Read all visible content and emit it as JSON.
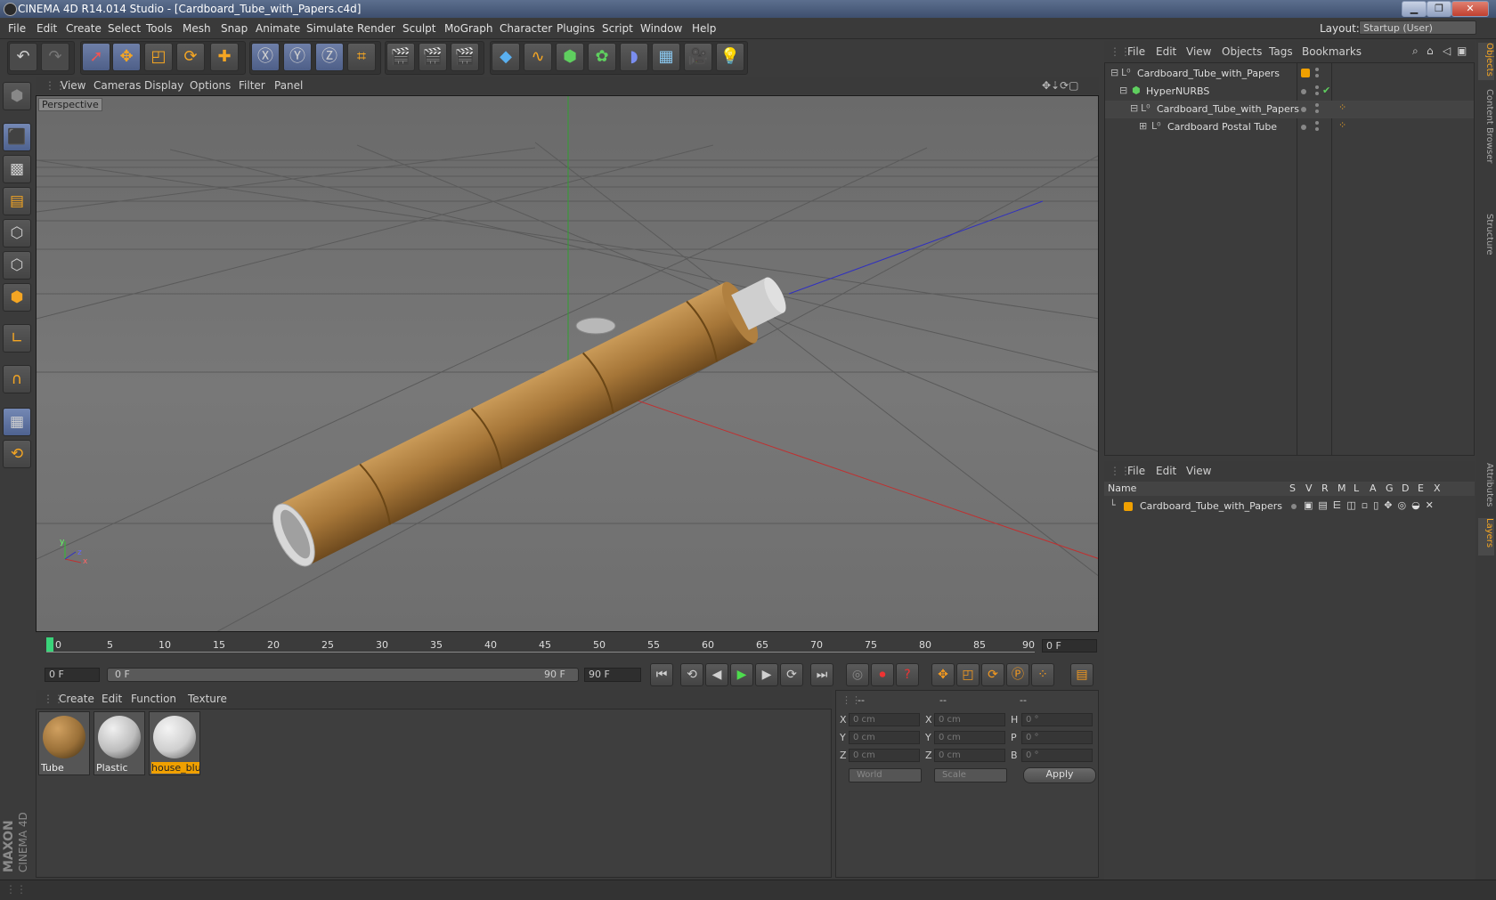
{
  "titlebar": {
    "title": "CINEMA 4D R14.014 Studio - [Cardboard_Tube_with_Papers.c4d]",
    "minimize": "▁",
    "maximize": "❐",
    "close": "✕"
  },
  "menubar": {
    "items": [
      "File",
      "Edit",
      "Create",
      "Select",
      "Tools",
      "Mesh",
      "Snap",
      "Animate",
      "Simulate",
      "Render",
      "Sculpt",
      "MoGraph",
      "Character",
      "Plugins",
      "Script",
      "Window",
      "Help"
    ],
    "layout_label": "Layout:",
    "layout_value": "Startup (User)"
  },
  "viewport": {
    "menu": [
      "View",
      "Cameras",
      "Display",
      "Options",
      "Filter",
      "Panel"
    ],
    "label": "Perspective",
    "axis": {
      "x": "x",
      "y": "y",
      "z": "z"
    }
  },
  "timeline": {
    "ticks": [
      "0",
      "5",
      "10",
      "15",
      "20",
      "25",
      "30",
      "35",
      "40",
      "45",
      "50",
      "55",
      "60",
      "65",
      "70",
      "75",
      "80",
      "85",
      "90"
    ],
    "current_frame": "0 F"
  },
  "transport": {
    "start": "0 F",
    "range_start": "0 F",
    "range_end": "90 F",
    "end": "90 F"
  },
  "materials": {
    "menu": [
      "Create",
      "Edit",
      "Function",
      "Texture"
    ],
    "items": [
      {
        "label": "Tube",
        "color": "#9a7038"
      },
      {
        "label": "Plastic",
        "color": "#bdbdbd"
      },
      {
        "label": "house_blu",
        "color": "#cfcfcf"
      }
    ]
  },
  "coords": {
    "header_a": "--",
    "header_b": "--",
    "header_c": "--",
    "rows": [
      {
        "l1": "X",
        "v1": "0 cm",
        "l2": "X",
        "v2": "0 cm",
        "l3": "H",
        "v3": "0 °"
      },
      {
        "l1": "Y",
        "v1": "0 cm",
        "l2": "Y",
        "v2": "0 cm",
        "l3": "P",
        "v3": "0 °"
      },
      {
        "l1": "Z",
        "v1": "0 cm",
        "l2": "Z",
        "v2": "0 cm",
        "l3": "B",
        "v3": "0 °"
      }
    ],
    "world": "World",
    "scale": "Scale",
    "apply": "Apply"
  },
  "objects": {
    "menu": [
      "File",
      "Edit",
      "View",
      "Objects",
      "Tags",
      "Bookmarks"
    ],
    "rows": [
      {
        "name": "Cardboard_Tube_with_Papers"
      },
      {
        "name": "HyperNURBS"
      },
      {
        "name": "Cardboard_Tube_with_Papers"
      },
      {
        "name": "Cardboard Postal Tube"
      }
    ]
  },
  "layers": {
    "menu": [
      "File",
      "Edit",
      "View"
    ],
    "headers": {
      "name": "Name",
      "s": "S",
      "v": "V",
      "r": "R",
      "m": "M",
      "l": "L",
      "a": "A",
      "g": "G",
      "d": "D",
      "e": "E",
      "x": "X"
    },
    "row": "Cardboard_Tube_with_Papers"
  },
  "right_tabs": [
    "Objects",
    "Content Browser",
    "Structure",
    "Attributes",
    "Layers"
  ],
  "brand": {
    "line1": "MAXON",
    "line2": "CINEMA 4D"
  },
  "colors": {
    "accent": "#f0a000",
    "x_axis": "#c03030",
    "y_axis": "#30a030",
    "z_axis": "#3030c0"
  }
}
